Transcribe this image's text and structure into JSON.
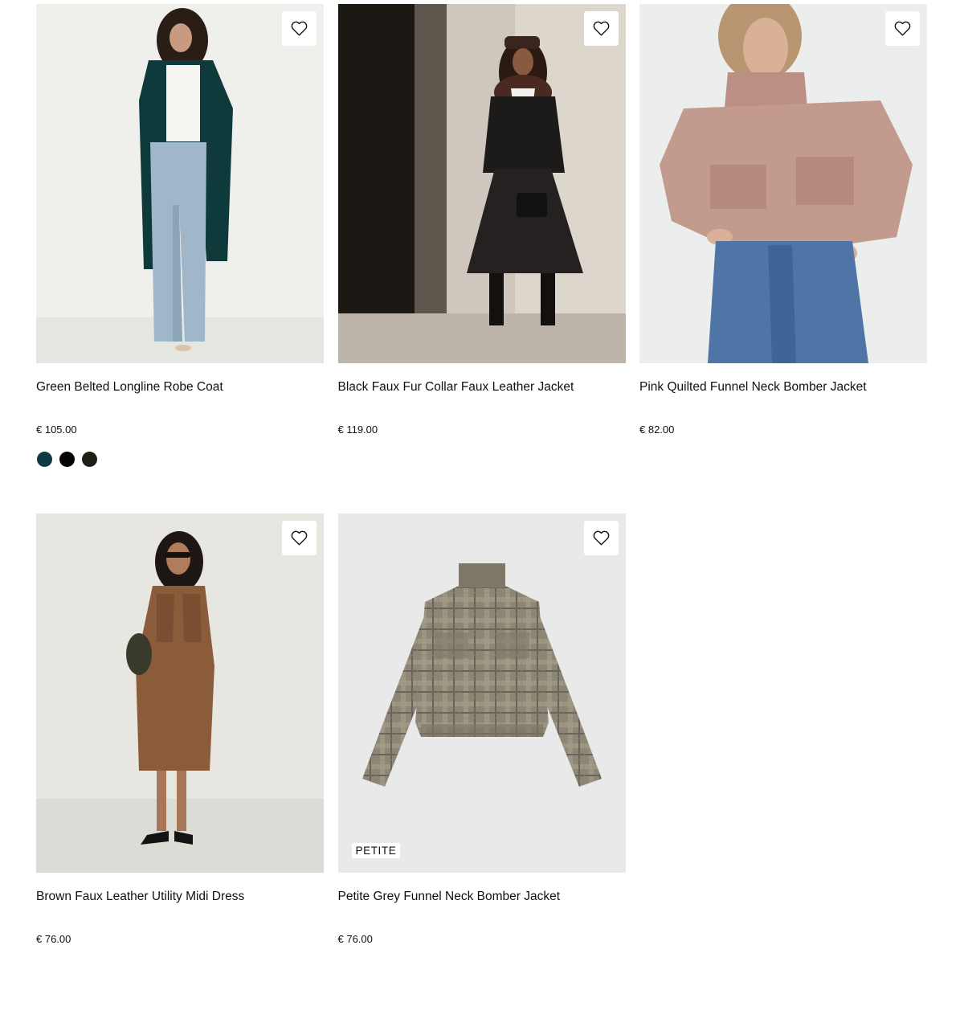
{
  "products": [
    {
      "title": "Green Belted Longline Robe Coat",
      "price": "€ 105.00",
      "image": "woman-green-longline-coat-photo",
      "badge": "",
      "swatches": [
        "#0d3b45",
        "#050505",
        "#1f1f14"
      ]
    },
    {
      "title": "Black Faux Fur Collar Faux Leather Jacket",
      "price": "€ 119.00",
      "image": "woman-black-faux-leather-jacket-photo",
      "badge": "",
      "swatches": []
    },
    {
      "title": "Pink Quilted Funnel Neck Bomber Jacket",
      "price": "€ 82.00",
      "image": "woman-pink-quilted-bomber-photo",
      "badge": "",
      "swatches": []
    },
    {
      "title": "Brown Faux Leather Utility Midi Dress",
      "price": "€ 76.00",
      "image": "woman-brown-leather-midi-dress-photo",
      "badge": "",
      "swatches": []
    },
    {
      "title": "Petite Grey Funnel Neck Bomber Jacket",
      "price": "€ 76.00",
      "image": "grey-check-bomber-jacket-flatlay-photo",
      "badge": "PETITE",
      "swatches": []
    }
  ],
  "icons": {
    "wishlist": "heart-outline-icon"
  },
  "colors": {
    "text": "#111111",
    "card_bg": "#ffffff"
  }
}
